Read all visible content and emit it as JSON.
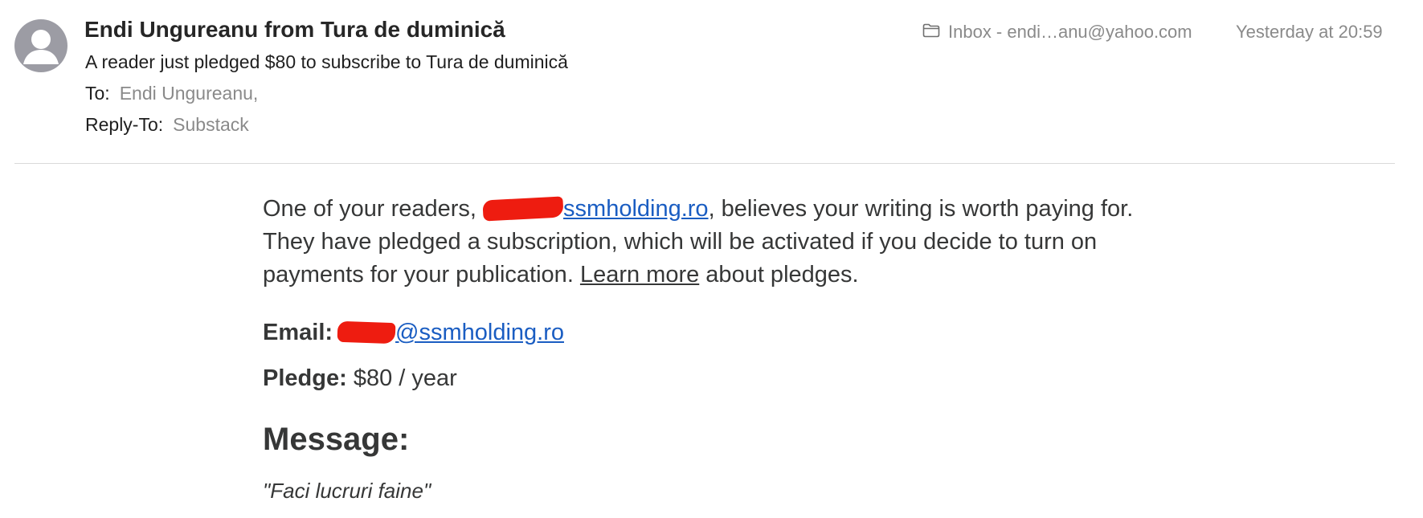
{
  "header": {
    "sender": "Endi Ungureanu from Tura de duminică",
    "subject": "A reader just pledged $80 to subscribe to Tura de duminică",
    "to_label": "To:",
    "to_value": "Endi Ungureanu,",
    "reply_to_label": "Reply-To:",
    "reply_to_value": "Substack",
    "mailbox": "Inbox - endi…anu@yahoo.com",
    "timestamp": "Yesterday at 20:59",
    "icons": {
      "avatar": "person-avatar-icon",
      "mailbox": "folder-icon"
    }
  },
  "body": {
    "intro_part1": "One of your readers, ",
    "intro_link": "ssmholding.ro",
    "intro_part2": ", believes your writing is worth paying for. They have pledged a subscription, which will be activated if you decide to turn on payments for your publication. ",
    "learn_more": "Learn more",
    "intro_part3": " about pledges.",
    "email_label": "Email:",
    "email_value": "@ssmholding.ro",
    "pledge_label": "Pledge:",
    "pledge_value": "$80 / year",
    "message_heading": "Message:",
    "message_text": "\"Faci lucruri faine\""
  },
  "colors": {
    "link": "#1a5dc2",
    "redaction": "#ee1c10",
    "muted": "#8a8a8a",
    "avatar": "#9c9ca4"
  }
}
